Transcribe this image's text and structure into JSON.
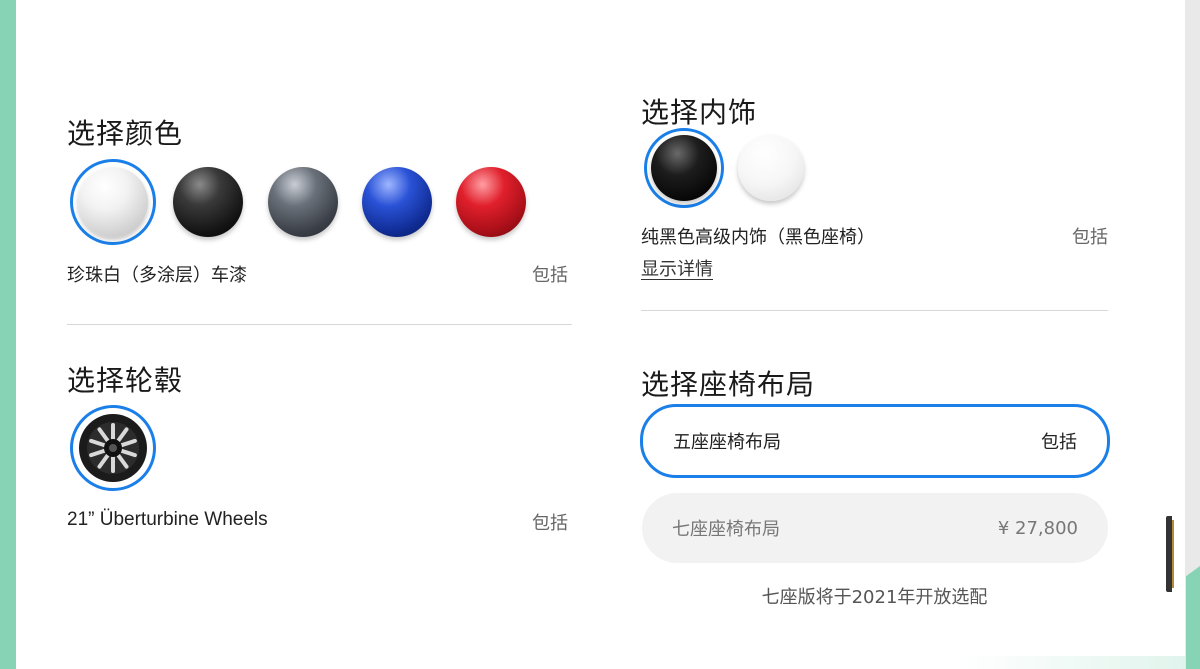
{
  "color_section": {
    "title": "选择颜色",
    "selected_name": "珍珠白（多涂层）车漆",
    "price": "包括",
    "swatches": [
      {
        "name": "pearl-white",
        "color": "#e9e9e9"
      },
      {
        "name": "solid-black",
        "color": "#1c1c1c"
      },
      {
        "name": "midnight-silver",
        "color": "#4b5058"
      },
      {
        "name": "deep-blue",
        "color": "#1436a0"
      },
      {
        "name": "red-multi-coat",
        "color": "#b8121c"
      }
    ]
  },
  "wheel_section": {
    "title": "选择轮毂",
    "selected_name": "21” Überturbine Wheels",
    "price": "包括"
  },
  "interior_section": {
    "title": "选择内饰",
    "selected_name": "纯黑色高级内饰（黑色座椅）",
    "price": "包括",
    "details_link": "显示详情",
    "swatches": [
      {
        "name": "black",
        "color": "#111111"
      },
      {
        "name": "white",
        "color": "#f4f4f4"
      }
    ]
  },
  "seat_section": {
    "title": "选择座椅布局",
    "options": [
      {
        "label": "五座座椅布局",
        "price": "包括"
      },
      {
        "label": "七座座椅布局",
        "price": "¥ 27,800"
      }
    ],
    "note": "七座版将于2021年开放选配"
  }
}
